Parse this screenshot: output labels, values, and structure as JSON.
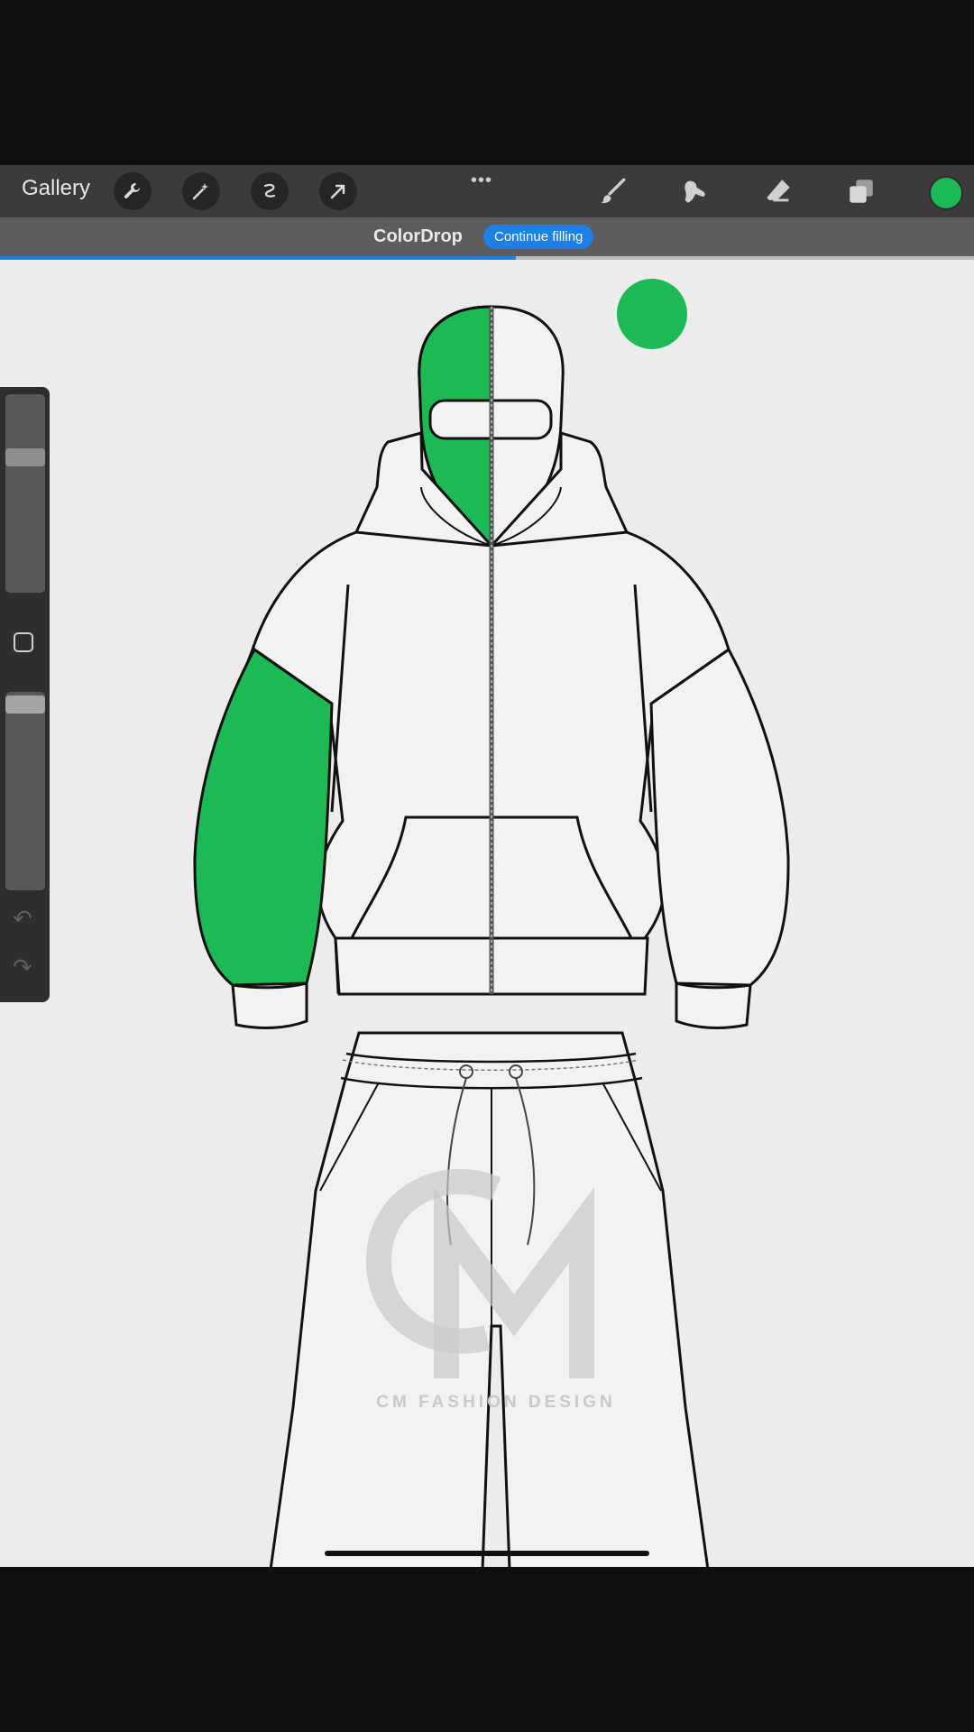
{
  "toolbar": {
    "gallery_label": "Gallery",
    "left_tools": [
      "wrench-icon",
      "magic-wand-icon",
      "selection-icon",
      "transform-arrow-icon"
    ],
    "right_tools": [
      "brush-icon",
      "smudge-icon",
      "eraser-icon",
      "layers-icon"
    ],
    "current_color": "#1db954"
  },
  "notification": {
    "title": "ColorDrop",
    "action_label": "Continue filling",
    "progress": 0.53
  },
  "canvas": {
    "fill_color": "#1db954",
    "watermark_text": "CM FASHION DESIGN"
  },
  "sidebar": {
    "brush_size_level": 0.7,
    "opacity_level": 0.98
  }
}
